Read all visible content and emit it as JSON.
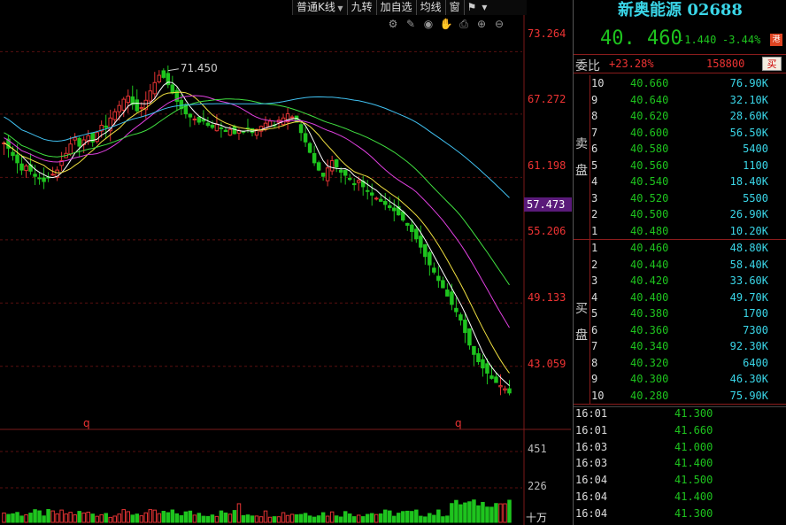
{
  "toolbar": {
    "kline_type": "普通K线",
    "jiuzhuan": "九转",
    "add_watch": "加自选",
    "ma_lines": "均线",
    "window": "窗",
    "flag_icon": "flag-icon",
    "menu_icon": "caret-down-icon"
  },
  "chart_tools": [
    "settings-icon",
    "pen-icon",
    "eye-icon",
    "hand-icon",
    "print-icon",
    "zoom-in-icon",
    "zoom-out-icon"
  ],
  "chart": {
    "price_axis": [
      "73.264",
      "67.272",
      "61.198",
      "55.206",
      "49.133",
      "43.059"
    ],
    "current_price_tag": "57.473",
    "high_marker": "71.450",
    "q_marker": "q",
    "volume_axis": [
      "451",
      "226"
    ],
    "volume_unit": "十万"
  },
  "chart_data": {
    "type": "candlestick",
    "title": "",
    "ylim": [
      37.0,
      75.0
    ],
    "high_label": 71.45,
    "closes": [
      64.5,
      64.0,
      63.3,
      62.6,
      61.9,
      62.3,
      61.8,
      61.3,
      61.1,
      60.8,
      61.2,
      61.5,
      61.9,
      62.8,
      63.5,
      64.4,
      65.0,
      64.2,
      64.8,
      65.2,
      64.6,
      65.5,
      66.2,
      66.0,
      66.9,
      67.5,
      68.1,
      68.7,
      69.0,
      68.2,
      67.6,
      67.9,
      68.6,
      69.5,
      70.3,
      71.0,
      70.8,
      70.1,
      69.3,
      68.5,
      67.8,
      67.3,
      67.0,
      66.8,
      66.5,
      66.6,
      66.2,
      66.0,
      66.3,
      65.9,
      65.6,
      65.8,
      65.4,
      65.7,
      65.6,
      65.9,
      65.5,
      65.8,
      66.1,
      66.4,
      66.6,
      66.2,
      66.7,
      66.9,
      67.3,
      67.0,
      66.5,
      65.5,
      64.6,
      63.6,
      62.6,
      61.9,
      61.3,
      62.1,
      62.8,
      62.2,
      61.7,
      61.4,
      61.0,
      60.5,
      60.9,
      60.3,
      59.9,
      59.5,
      59.2,
      58.9,
      58.6,
      58.3,
      58.0,
      57.6,
      57.1,
      56.6,
      56.0,
      55.3,
      54.5,
      53.6,
      52.8,
      52.1,
      51.3,
      50.6,
      49.8,
      49.0,
      48.3,
      47.5,
      46.3,
      45.1,
      44.2,
      43.5,
      42.9,
      42.4,
      41.9,
      41.5,
      41.2,
      40.9,
      40.5
    ],
    "volume_ylim": [
      0,
      451
    ],
    "ma_series": [
      "MA5",
      "MA10",
      "MA20",
      "MA30",
      "MA60"
    ]
  },
  "quote": {
    "title": "新奥能源 02688",
    "last_price": "40. 460",
    "change_abs": "-1.440",
    "change_pct": "-3.44%",
    "market_badge": "港"
  },
  "ratio": {
    "label": "委比",
    "value": "+23.28%",
    "diff": "158800",
    "buy_button": "买"
  },
  "ask_label_top": "卖",
  "ask_label_bottom": "盘",
  "bid_label_top": "买",
  "bid_label_bottom": "盘",
  "asks": [
    {
      "lvl": "10",
      "px": "40.660",
      "qty": "76.90K"
    },
    {
      "lvl": "9",
      "px": "40.640",
      "qty": "32.10K"
    },
    {
      "lvl": "8",
      "px": "40.620",
      "qty": "28.60K"
    },
    {
      "lvl": "7",
      "px": "40.600",
      "qty": "56.50K"
    },
    {
      "lvl": "6",
      "px": "40.580",
      "qty": "5400"
    },
    {
      "lvl": "5",
      "px": "40.560",
      "qty": "1100"
    },
    {
      "lvl": "4",
      "px": "40.540",
      "qty": "18.40K"
    },
    {
      "lvl": "3",
      "px": "40.520",
      "qty": "5500"
    },
    {
      "lvl": "2",
      "px": "40.500",
      "qty": "26.90K"
    },
    {
      "lvl": "1",
      "px": "40.480",
      "qty": "10.20K"
    }
  ],
  "bids": [
    {
      "lvl": "1",
      "px": "40.460",
      "qty": "48.80K"
    },
    {
      "lvl": "2",
      "px": "40.440",
      "qty": "58.40K"
    },
    {
      "lvl": "3",
      "px": "40.420",
      "qty": "33.60K"
    },
    {
      "lvl": "4",
      "px": "40.400",
      "qty": "49.70K"
    },
    {
      "lvl": "5",
      "px": "40.380",
      "qty": "1700"
    },
    {
      "lvl": "6",
      "px": "40.360",
      "qty": "7300"
    },
    {
      "lvl": "7",
      "px": "40.340",
      "qty": "92.30K"
    },
    {
      "lvl": "8",
      "px": "40.320",
      "qty": "6400"
    },
    {
      "lvl": "9",
      "px": "40.300",
      "qty": "46.30K"
    },
    {
      "lvl": "10",
      "px": "40.280",
      "qty": "75.90K"
    }
  ],
  "ticks": [
    {
      "t": "16:01",
      "p": "41.300"
    },
    {
      "t": "16:01",
      "p": "41.660"
    },
    {
      "t": "16:03",
      "p": "41.000"
    },
    {
      "t": "16:03",
      "p": "41.400"
    },
    {
      "t": "16:04",
      "p": "41.500"
    },
    {
      "t": "16:04",
      "p": "41.400"
    },
    {
      "t": "16:04",
      "p": "41.300"
    }
  ],
  "colors": {
    "up": "#e33333",
    "down": "#1ec41e",
    "ma5": "#ffffff",
    "ma10": "#f0e040",
    "ma20": "#e040e0",
    "ma30": "#40e040",
    "ma60": "#40c0f0",
    "grid": "#5a1010"
  }
}
